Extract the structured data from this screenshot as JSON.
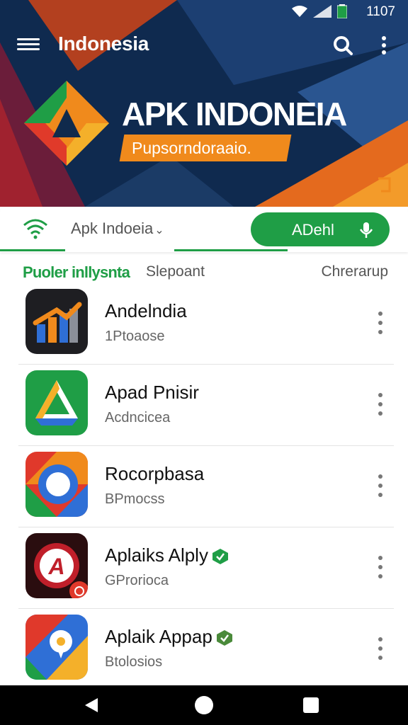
{
  "status": {
    "time": "1107"
  },
  "appbar": {
    "title": "Indonesia"
  },
  "hero": {
    "title": "APK INDONEIA",
    "badge": "Pupsorndoraaio."
  },
  "filter": {
    "select_label": "Apk Indoeia",
    "button_label": "ADehl"
  },
  "section": {
    "primary": "Puoler inllysnta",
    "secondary": "Slepoant",
    "right": "Chrerarup"
  },
  "apps": [
    {
      "name": "Andelndia",
      "sub": "1Ptoaose",
      "icon": "bar-chart-app-icon"
    },
    {
      "name": "Apad Pnisir",
      "sub": "Acdncicea",
      "icon": "drive-like-app-icon"
    },
    {
      "name": "Rocorpbasa",
      "sub": "BPmocss",
      "icon": "camera-like-app-icon"
    },
    {
      "name": "Aplaiks Alply",
      "sub": "GProrioca",
      "icon": "red-circle-logo-app-icon",
      "verified": true
    },
    {
      "name": "Aplaik Appap",
      "sub": "Btolosios",
      "icon": "maps-like-app-icon",
      "verified": true
    }
  ],
  "colors": {
    "accent": "#1f9e46",
    "hero_bg": "#102a4c",
    "badge": "#f08a1c"
  }
}
